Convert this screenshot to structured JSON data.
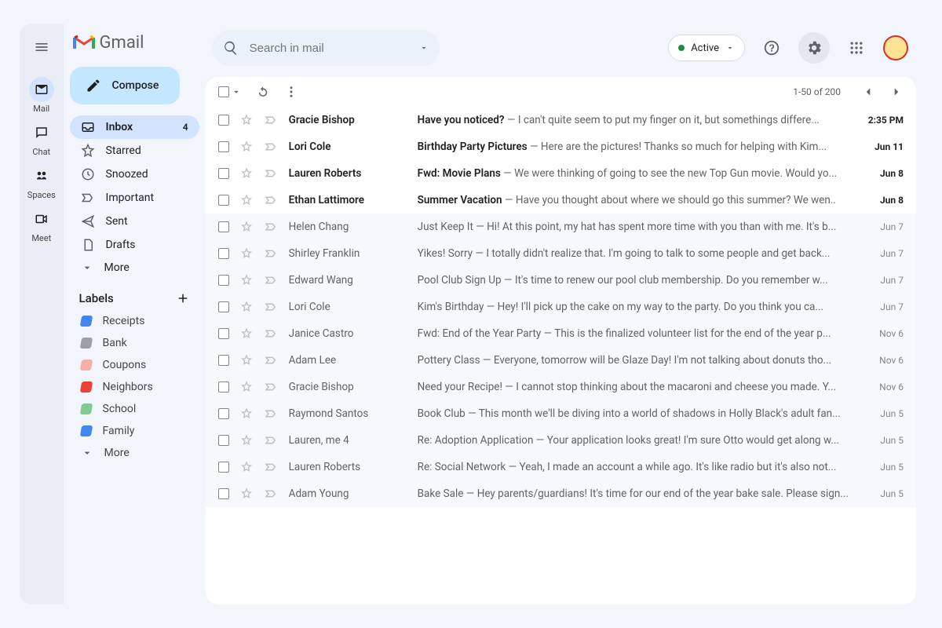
{
  "brand": {
    "name": "Gmail"
  },
  "search": {
    "placeholder": "Search in mail"
  },
  "status": {
    "label": "Active"
  },
  "compose": {
    "label": "Compose"
  },
  "rail": [
    {
      "id": "mail",
      "label": "Mail",
      "selected": true
    },
    {
      "id": "chat",
      "label": "Chat",
      "selected": false
    },
    {
      "id": "spaces",
      "label": "Spaces",
      "selected": false
    },
    {
      "id": "meet",
      "label": "Meet",
      "selected": false
    }
  ],
  "folders": [
    {
      "id": "inbox",
      "label": "Inbox",
      "icon": "inbox",
      "selected": true,
      "count": "4"
    },
    {
      "id": "starred",
      "label": "Starred",
      "icon": "star"
    },
    {
      "id": "snoozed",
      "label": "Snoozed",
      "icon": "clock"
    },
    {
      "id": "important",
      "label": "Important",
      "icon": "important"
    },
    {
      "id": "sent",
      "label": "Sent",
      "icon": "send"
    },
    {
      "id": "drafts",
      "label": "Drafts",
      "icon": "file"
    },
    {
      "id": "more",
      "label": "More",
      "icon": "chevron-down"
    }
  ],
  "labels_header": "Labels",
  "labels": [
    {
      "name": "Receipts",
      "color": "#4285f4"
    },
    {
      "name": "Bank",
      "color": "#9aa0a6"
    },
    {
      "name": "Coupons",
      "color": "#f6aea9"
    },
    {
      "name": "Neighbors",
      "color": "#ea4335"
    },
    {
      "name": "School",
      "color": "#81c995"
    },
    {
      "name": "Family",
      "color": "#4285f4"
    }
  ],
  "labels_more": "More",
  "page_info": "1-50 of 200",
  "rows": [
    {
      "unread": true,
      "sender": "Gracie Bishop",
      "subject": "Have you noticed?",
      "snippet": "I can't quite seem to put my finger on it, but somethings differe...",
      "date": "2:35 PM"
    },
    {
      "unread": true,
      "sender": "Lori Cole",
      "subject": "Birthday Party Pictures",
      "snippet": "Here are the pictures! Thanks so much for helping with Kim...",
      "date": "Jun 11"
    },
    {
      "unread": true,
      "sender": "Lauren Roberts",
      "subject": "Fwd: Movie Plans",
      "snippet": "We were thinking of going to see the new Top Gun movie. Would yo...",
      "date": "Jun 8"
    },
    {
      "unread": true,
      "sender": "Ethan Lattimore",
      "subject": "Summer Vacation",
      "snippet": "Have you thought about where we should go this summer? We wen..",
      "date": "Jun 8"
    },
    {
      "unread": false,
      "sender": "Helen Chang",
      "subject": "Just Keep It",
      "snippet": "Hi! At this point, my hat has spent more time with you than with me. It's b...",
      "date": "Jun 7"
    },
    {
      "unread": false,
      "sender": "Shirley Franklin",
      "subject": "Yikes! Sorry",
      "snippet": "I totally didn't realize that. I'm going to talk to some people and get back...",
      "date": "Jun 7"
    },
    {
      "unread": false,
      "sender": "Edward Wang",
      "subject": "Pool Club Sign Up",
      "snippet": "It's time to renew our pool club membership. Do you remember w...",
      "date": "Jun 7"
    },
    {
      "unread": false,
      "sender": "Lori Cole",
      "subject": "Kim's Birthday",
      "snippet": "Hey! I'll pick up the cake on my way to the party. Do you think you ca...",
      "date": "Jun 7"
    },
    {
      "unread": false,
      "sender": "Janice Castro",
      "subject": "Fwd: End of the Year Party",
      "snippet": "This is the finalized volunteer list for the end of the year p...",
      "date": "Nov 6"
    },
    {
      "unread": false,
      "sender": "Adam Lee",
      "subject": "Pottery Class",
      "snippet": "Everyone, tomorrow will be Glaze Day! I'm not talking about donuts tho...",
      "date": "Nov 6"
    },
    {
      "unread": false,
      "sender": "Gracie Bishop",
      "subject": "Need your Recipe!",
      "snippet": "I cannot stop thinking about the macaroni and cheese you made. Y...",
      "date": "Nov 6"
    },
    {
      "unread": false,
      "sender": "Raymond Santos",
      "subject": "Book Club",
      "snippet": "This month we'll be diving into a world of shadows in Holly Black's adult fan...",
      "date": "Jun 5"
    },
    {
      "unread": false,
      "sender": "Lauren, me  4",
      "subject": "Re: Adoption Application",
      "snippet": "Your application looks great! I'm sure Otto would get along w...",
      "date": "Jun 5"
    },
    {
      "unread": false,
      "sender": "Lauren Roberts",
      "subject": "Re: Social Network",
      "snippet": "Yeah, I made an account a while ago. It's like radio but it's also not...",
      "date": "Jun 5"
    },
    {
      "unread": false,
      "sender": "Adam Young",
      "subject": "Bake Sale",
      "snippet": "Hey parents/guardians! It's time for our end of the year bake sale. Please sign...",
      "date": "Jun 5"
    }
  ]
}
